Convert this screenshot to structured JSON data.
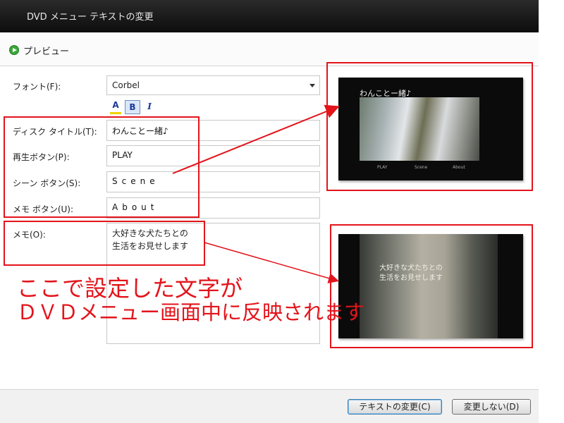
{
  "window": {
    "title": "DVD メニュー テキストの変更"
  },
  "preview": {
    "label": "プレビュー"
  },
  "form": {
    "font_label": "フォント(F):",
    "font_value": "Corbel",
    "format": {
      "color": "A",
      "bold": "B",
      "italic": "I"
    },
    "disc_title_label": "ディスク タイトル(T):",
    "disc_title_value": "わんことー緒♪",
    "play_label": "再生ボタン(P):",
    "play_value": "PLAY",
    "scene_label": "シーン ボタン(S):",
    "scene_value": "Scene",
    "memo_button_label": "メモ ボタン(U):",
    "memo_button_value": "About",
    "memo_label": "メモ(O):",
    "memo_line1": "大好きな犬たちとの",
    "memo_line2": "生活をお見せします"
  },
  "annotation": {
    "line1": "ここで設定した文字が",
    "line2": "ＤＶＤメニュー画面中に反映されます",
    "color": "#e3141b"
  },
  "thumb1": {
    "title": "わんことー緒♪",
    "btn_play": "PLAY",
    "btn_scene": "Scene",
    "btn_about": "About"
  },
  "thumb2": {
    "line1": "大好きな犬たちとの",
    "line2": "生活をお見せします"
  },
  "buttons": {
    "apply": "テキストの変更(C)",
    "cancel": "変更しない(D)"
  }
}
